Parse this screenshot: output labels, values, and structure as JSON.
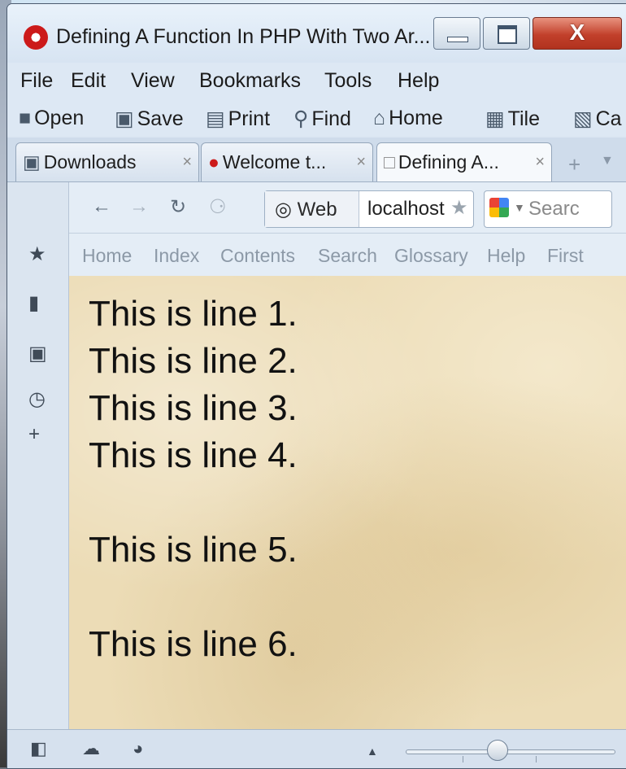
{
  "window": {
    "title": "Defining A Function In PHP With Two Ar...",
    "close_glyph": "X"
  },
  "menu": {
    "items": [
      {
        "label": "File"
      },
      {
        "label": "Edit"
      },
      {
        "label": "View"
      },
      {
        "label": "Bookmarks"
      },
      {
        "label": "Tools"
      },
      {
        "label": "Help"
      }
    ]
  },
  "toolbar": {
    "open": "Open",
    "save": "Save",
    "print": "Print",
    "find": "Find",
    "home": "Home",
    "tile": "Tile",
    "cascade": "Ca"
  },
  "tabs": [
    {
      "label": "Downloads",
      "icon": "downloads-icon"
    },
    {
      "label": "Welcome t...",
      "icon": "opera-icon"
    },
    {
      "label": "Defining A...",
      "icon": "page-icon",
      "active": true
    }
  ],
  "address": {
    "web_label": "Web",
    "url": "localhost"
  },
  "search": {
    "placeholder": "Searc"
  },
  "links": [
    {
      "label": "Home"
    },
    {
      "label": "Index"
    },
    {
      "label": "Contents"
    },
    {
      "label": "Search"
    },
    {
      "label": "Glossary"
    },
    {
      "label": "Help"
    },
    {
      "label": "First"
    }
  ],
  "content": {
    "lines": [
      "This is line 1.",
      "This is line 2.",
      "This is line 3.",
      "This is line 4.",
      "This is line 5.",
      "This is line 6."
    ]
  },
  "zoom": {
    "level": 0.55
  }
}
